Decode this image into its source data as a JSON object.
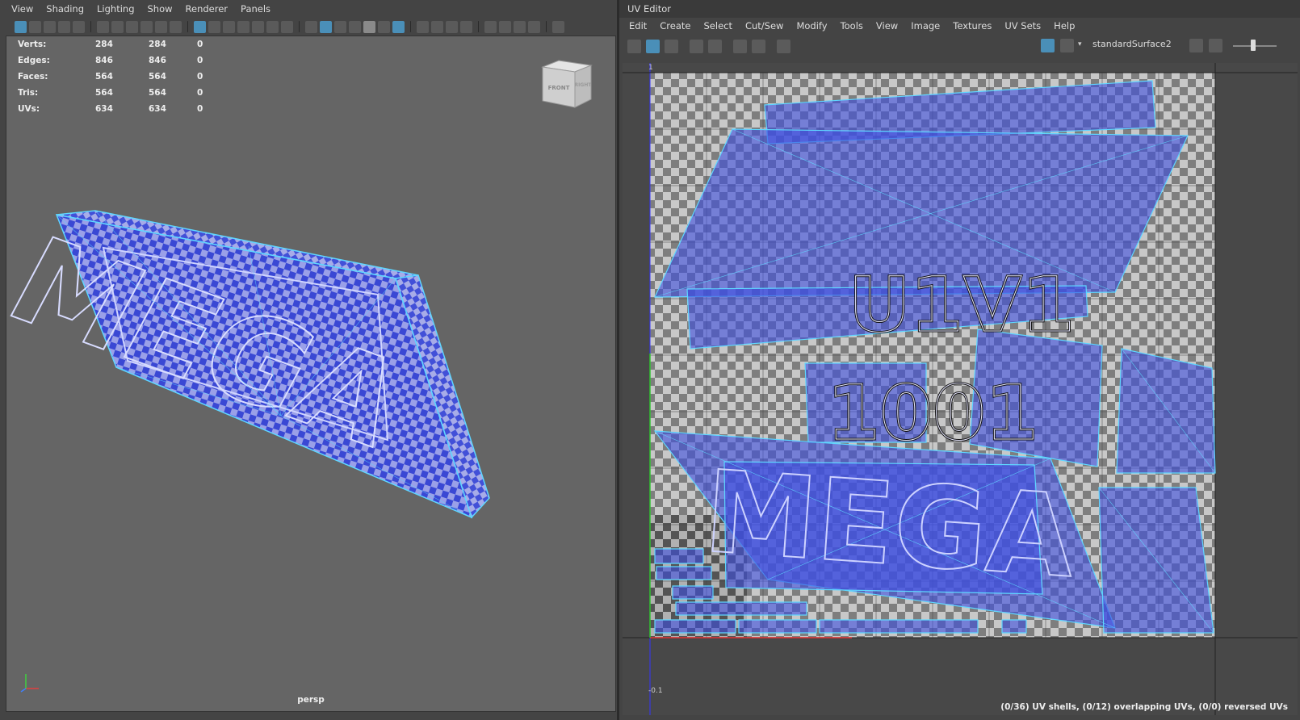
{
  "viewport": {
    "menu": [
      "View",
      "Shading",
      "Lighting",
      "Show",
      "Renderer",
      "Panels"
    ],
    "hud": [
      {
        "label": "Verts:",
        "v1": "284",
        "v2": "284",
        "v3": "0"
      },
      {
        "label": "Edges:",
        "v1": "846",
        "v2": "846",
        "v3": "0"
      },
      {
        "label": "Faces:",
        "v1": "564",
        "v2": "564",
        "v3": "0"
      },
      {
        "label": "Tris:",
        "v1": "564",
        "v2": "564",
        "v3": "0"
      },
      {
        "label": "UVs:",
        "v1": "634",
        "v2": "634",
        "v3": "0"
      }
    ],
    "camera_label": "persp",
    "viewcube": {
      "front": "FRONT",
      "right": "RIGHT"
    },
    "model_text": "MEGA"
  },
  "uv_editor": {
    "title": "UV Editor",
    "menu": [
      "Edit",
      "Create",
      "Select",
      "Cut/Sew",
      "Modify",
      "Tools",
      "View",
      "Image",
      "Textures",
      "UV Sets",
      "Help"
    ],
    "material": "standardSurface2",
    "tile_text_1": "U1V1",
    "tile_text_2": "1001",
    "axis_labels": {
      "top": "1",
      "bottom": "-0.1"
    },
    "status": "(0/36) UV shells, (0/12) overlapping UVs, (0/0) reversed UVs"
  },
  "colors": {
    "uv_blue": "#3d4fe0",
    "wire": "#5fd6ff",
    "viewport_bg": "#656565"
  }
}
